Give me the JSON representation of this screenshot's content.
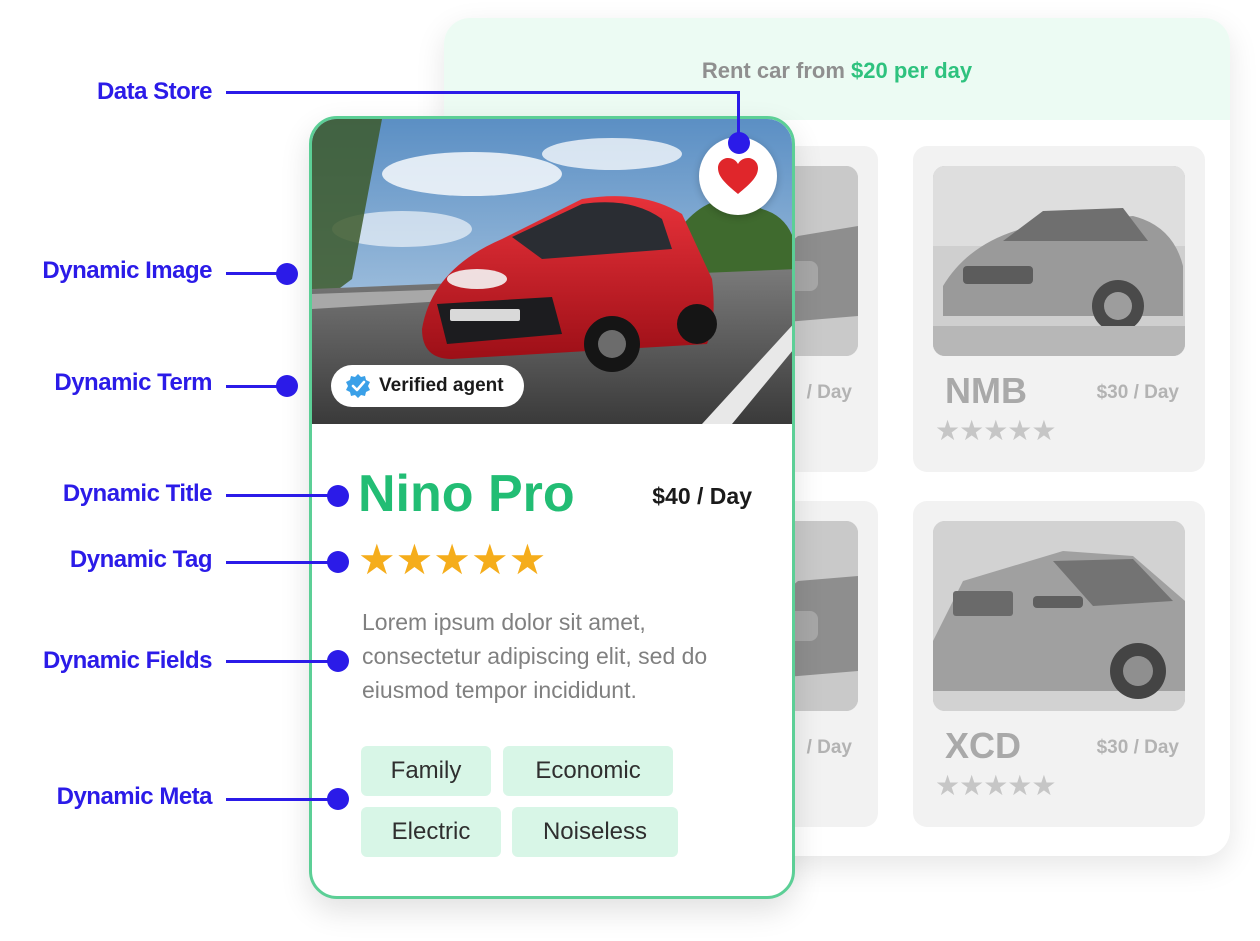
{
  "header": {
    "prefix": "Rent car from ",
    "highlight": "$20 per day"
  },
  "background_cards": [
    {
      "title": "NMB",
      "price": "$30 / Day",
      "stars": "★★★★★"
    },
    {
      "title": "XCD",
      "price": "$30 / Day",
      "stars": "★★★★★"
    }
  ],
  "partial_cards": [
    {
      "price": "/ Day"
    },
    {
      "price": "/ Day"
    }
  ],
  "main_card": {
    "badge": "Verified agent",
    "title": "Nino Pro",
    "price": "$40 / Day",
    "stars": "★★★★★",
    "rating": 5,
    "description": "Lorem ipsum dolor sit amet, consectetur adipiscing elit, sed do eiusmod tempor incididunt.",
    "tags": [
      "Family",
      "Economic",
      "Electric",
      "Noiseless"
    ]
  },
  "annotations": {
    "data_store": "Data Store",
    "dynamic_image": "Dynamic Image",
    "dynamic_term": "Dynamic Term",
    "dynamic_title": "Dynamic Title",
    "dynamic_tag": "Dynamic Tag",
    "dynamic_fields": "Dynamic Fields",
    "dynamic_meta": "Dynamic Meta"
  },
  "colors": {
    "accent_green": "#22bd74",
    "annotation_blue": "#2b1be8",
    "star_gold": "#f5ad1b",
    "heart_red": "#e0262b"
  },
  "icons": {
    "favorite": "heart-icon",
    "verified": "verified-badge-icon",
    "rating": "star-icon"
  }
}
